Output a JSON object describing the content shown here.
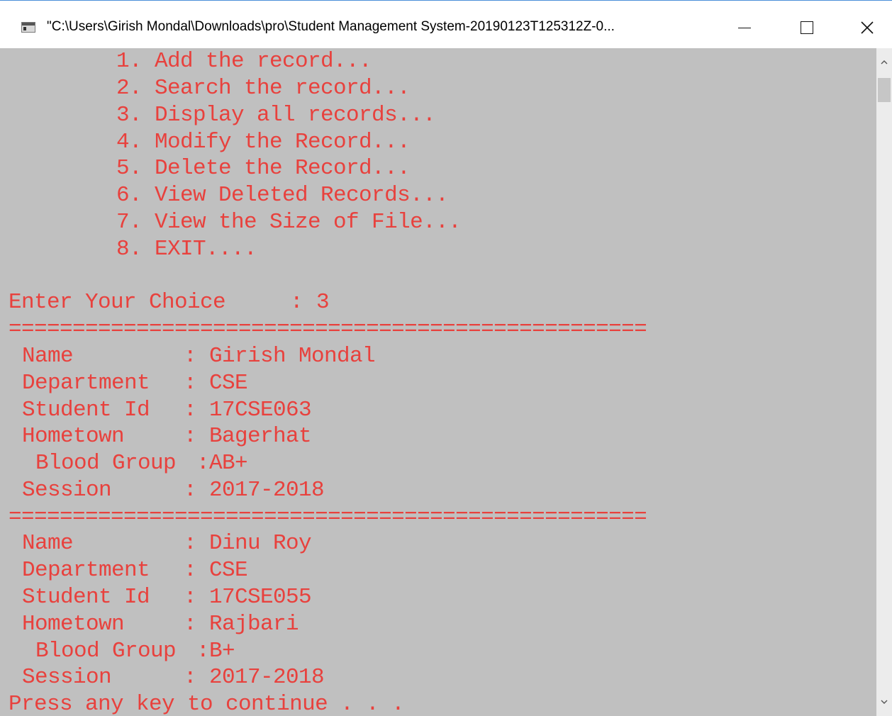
{
  "window": {
    "title": "\"C:\\Users\\Girish Mondal\\Downloads\\pro\\Student Management System-20190123T125312Z-0...",
    "icon": "console-window-icon",
    "controls": {
      "minimize": "minimize-icon",
      "maximize": "maximize-icon",
      "close": "close-icon"
    }
  },
  "colors": {
    "console_background": "#c0c0c0",
    "console_text": "#e8413d",
    "scrollbar_track": "#ececec"
  },
  "menu": [
    "1. Add the record...",
    "2. Search the record...",
    "3. Display all records...",
    "4. Modify the Record...",
    "5. Delete the Record...",
    "6. View Deleted Records...",
    "7. View the Size of File...",
    "8. EXIT...."
  ],
  "prompt": {
    "label": "Enter Your Choice",
    "separator": ":",
    "value": "3"
  },
  "divider": "==================================================",
  "records": [
    {
      "name": {
        "label": "Name",
        "value": "Girish Mondal"
      },
      "department": {
        "label": "Department",
        "value": "CSE"
      },
      "student_id": {
        "label": "Student Id",
        "value": "17CSE063"
      },
      "hometown": {
        "label": "Hometown",
        "value": "Bagerhat"
      },
      "blood_group": {
        "label": "Blood Group",
        "value": "AB+"
      },
      "session": {
        "label": "Session",
        "value": "2017-2018"
      }
    },
    {
      "name": {
        "label": "Name",
        "value": "Dinu Roy"
      },
      "department": {
        "label": "Department",
        "value": "CSE"
      },
      "student_id": {
        "label": "Student Id",
        "value": "17CSE055"
      },
      "hometown": {
        "label": "Hometown",
        "value": "Rajbari"
      },
      "blood_group": {
        "label": "Blood Group",
        "value": "B+"
      },
      "session": {
        "label": "Session",
        "value": "2017-2018"
      }
    }
  ],
  "footer": "Press any key to continue . . .",
  "scrollbar": {
    "up": "scroll-up-arrow-icon",
    "down": "scroll-down-arrow-icon"
  }
}
